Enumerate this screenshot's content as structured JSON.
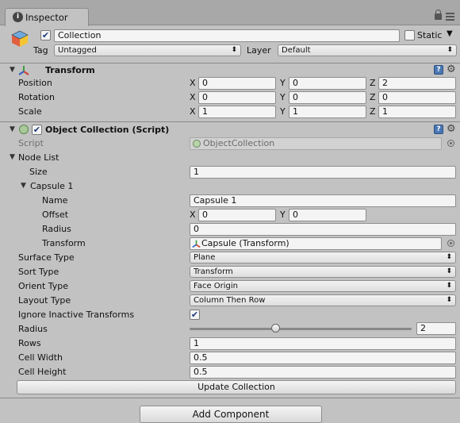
{
  "tab": {
    "title": "Inspector",
    "icon": "info-icon"
  },
  "gameobject": {
    "active": true,
    "name": "Collection",
    "static_label": "Static",
    "static": false,
    "tag_label": "Tag",
    "tag_value": "Untagged",
    "layer_label": "Layer",
    "layer_value": "Default"
  },
  "transform": {
    "title": "Transform",
    "position": {
      "label": "Position",
      "x": "0",
      "y": "0",
      "z": "2"
    },
    "rotation": {
      "label": "Rotation",
      "x": "0",
      "y": "0",
      "z": "0"
    },
    "scale": {
      "label": "Scale",
      "x": "1",
      "y": "1",
      "z": "1"
    },
    "axis_x": "X",
    "axis_y": "Y",
    "axis_z": "Z"
  },
  "collection": {
    "title": "Object Collection (Script)",
    "script_label": "Script",
    "script_value": "ObjectCollection",
    "node_list_label": "Node List",
    "size_label": "Size",
    "size_value": "1",
    "capsule_label": "Capsule 1",
    "name_label": "Name",
    "name_value": "Capsule 1",
    "offset_label": "Offset",
    "offset_x": "0",
    "offset_y": "0",
    "radius_label": "Radius",
    "node_radius_value": "0",
    "transform_label": "Transform",
    "transform_value": "Capsule (Transform)",
    "surface_type_label": "Surface Type",
    "surface_type_value": "Plane",
    "sort_type_label": "Sort Type",
    "sort_type_value": "Transform",
    "orient_type_label": "Orient Type",
    "orient_type_value": "Face Origin",
    "layout_type_label": "Layout Type",
    "layout_type_value": "Column Then Row",
    "ignore_inactive_label": "Ignore Inactive Transforms",
    "ignore_inactive": true,
    "slider_radius_label": "Radius",
    "slider_radius_value": "2",
    "slider_fraction": 0.39,
    "rows_label": "Rows",
    "rows_value": "1",
    "cell_width_label": "Cell Width",
    "cell_width_value": "0.5",
    "cell_height_label": "Cell Height",
    "cell_height_value": "0.5",
    "update_button": "Update Collection"
  },
  "add_component_button": "Add Component",
  "colors": {
    "panel": "#c2c2c2",
    "field": "#f4f4f4",
    "accent": "#4a78b4"
  }
}
